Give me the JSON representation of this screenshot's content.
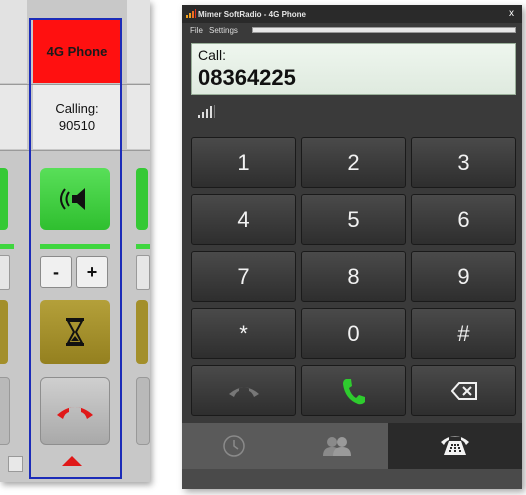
{
  "left_panel": {
    "header": "4G Phone",
    "calling_label": "Calling:",
    "calling_number": "90510",
    "volume_minus": "-",
    "volume_plus": "+",
    "colors": {
      "header": "#ff1010",
      "speaker": "#3fcf3f",
      "hold": "#a38f2b",
      "outline": "#1b2bb8"
    },
    "icons": [
      "speaker-icon",
      "hourglass-icon",
      "hangup-icon",
      "arrow-up-icon"
    ]
  },
  "window": {
    "title": "Mimer SoftRadio - 4G Phone",
    "close": "x",
    "menu": {
      "file": "File",
      "settings": "Settings"
    },
    "display": {
      "label": "Call:",
      "number": "08364225"
    },
    "keys": [
      "1",
      "2",
      "3",
      "4",
      "5",
      "6",
      "7",
      "8",
      "9",
      "*",
      "0",
      "#"
    ],
    "tabs": [
      "history-clock-icon",
      "contacts-icon",
      "dialpad-telephone-icon"
    ],
    "colors": {
      "call": "#2ecc2e",
      "end": "#777777",
      "background": "#3a3a3a"
    }
  }
}
